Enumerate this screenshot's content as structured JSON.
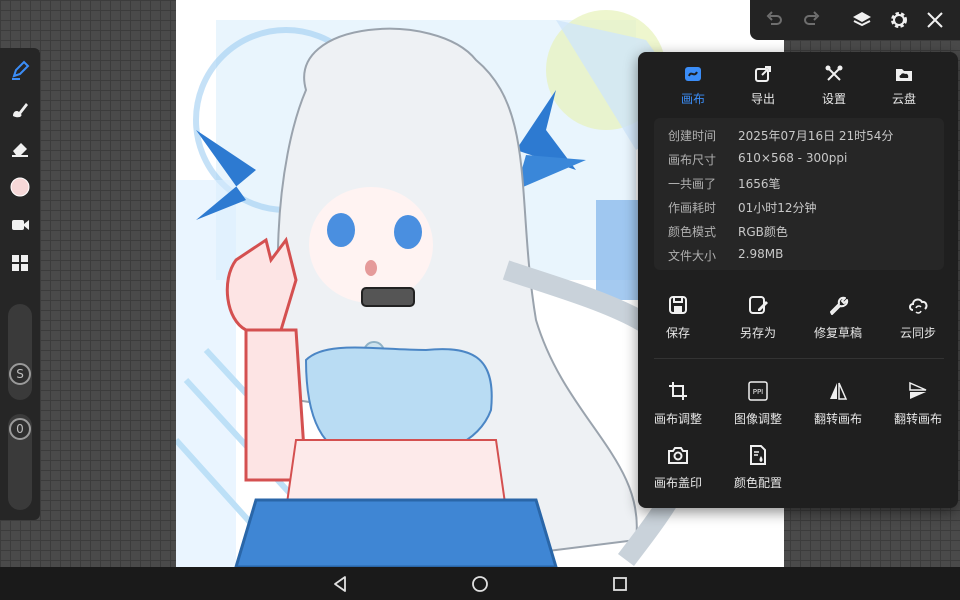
{
  "accent": "#3b8df7",
  "toolbar": {
    "tools": [
      {
        "icon": "brush-pen-icon",
        "active": true
      },
      {
        "icon": "smudge-icon"
      },
      {
        "icon": "eraser-icon"
      },
      {
        "icon": "color-swatch-icon",
        "color": "#f6d8d8"
      },
      {
        "icon": "video-record-icon"
      },
      {
        "icon": "layers-grid-icon"
      }
    ],
    "size_knob_label": "S",
    "opacity_knob_label": "0"
  },
  "topbar": {
    "icons": [
      "undo-icon",
      "redo-icon",
      "layers-icon",
      "settings-icon",
      "close-icon"
    ]
  },
  "panel": {
    "tabs": [
      {
        "label": "画布",
        "icon": "canvas-icon",
        "active": true
      },
      {
        "label": "导出",
        "icon": "export-icon"
      },
      {
        "label": "设置",
        "icon": "tools-icon"
      },
      {
        "label": "云盘",
        "icon": "cloud-drive-icon"
      }
    ],
    "info": [
      {
        "key": "创建时间",
        "value": "2025年07月16日 21时54分"
      },
      {
        "key": "画布尺寸",
        "value": "610×568 - 300ppi"
      },
      {
        "key": "一共画了",
        "value": "1656笔"
      },
      {
        "key": "作画耗时",
        "value": "01小时12分钟"
      },
      {
        "key": "颜色模式",
        "value": "RGB颜色"
      },
      {
        "key": "文件大小",
        "value": "2.98MB"
      }
    ],
    "actions_row1": [
      {
        "label": "保存",
        "icon": "save-icon"
      },
      {
        "label": "另存为",
        "icon": "save-as-icon"
      },
      {
        "label": "修复草稿",
        "icon": "repair-wrench-icon"
      },
      {
        "label": "云同步",
        "icon": "cloud-sync-icon"
      }
    ],
    "actions_row2": [
      {
        "label": "画布调整",
        "icon": "crop-icon"
      },
      {
        "label": "图像调整",
        "icon": "ppi-icon"
      },
      {
        "label": "翻转画布",
        "icon": "flip-horizontal-icon"
      },
      {
        "label": "翻转画布",
        "icon": "flip-vertical-icon"
      }
    ],
    "actions_row3": [
      {
        "label": "画布盖印",
        "icon": "camera-stamp-icon"
      },
      {
        "label": "颜色配置",
        "icon": "color-profile-icon"
      }
    ]
  },
  "navbar": {
    "buttons": [
      "back-icon",
      "home-icon",
      "recents-icon"
    ]
  }
}
